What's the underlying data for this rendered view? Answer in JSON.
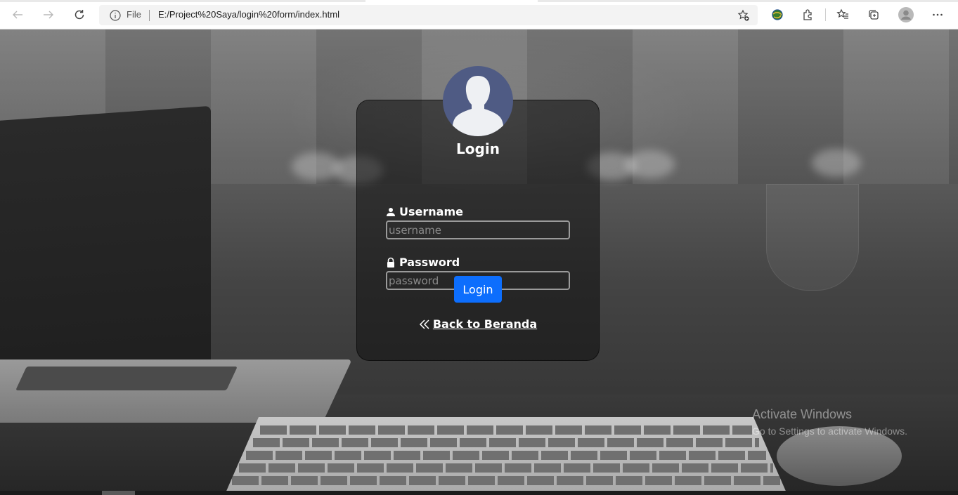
{
  "browser": {
    "address_prefix": "File",
    "url": "E:/Project%20Saya/login%20form/index.html",
    "icons": {
      "back": "back-arrow-icon",
      "forward": "forward-arrow-icon",
      "reload": "reload-icon",
      "info": "info-icon",
      "favorite": "favorite-add-icon",
      "extension1": "globe-extension-icon",
      "extensions": "extensions-icon",
      "favorites": "favorites-icon",
      "collections": "collections-icon",
      "profile": "profile-icon",
      "more": "more-icon"
    }
  },
  "login": {
    "title": "Login",
    "username_label": "Username",
    "username_placeholder": "username",
    "password_label": "Password",
    "password_placeholder": "password",
    "submit_label": "Login",
    "back_label": "Back to Beranda",
    "colors": {
      "button": "#0d6efd",
      "avatar_bg": "#4f5b84"
    }
  },
  "watermark": {
    "line1": "Activate Windows",
    "line2": "Go to Settings to activate Windows."
  }
}
